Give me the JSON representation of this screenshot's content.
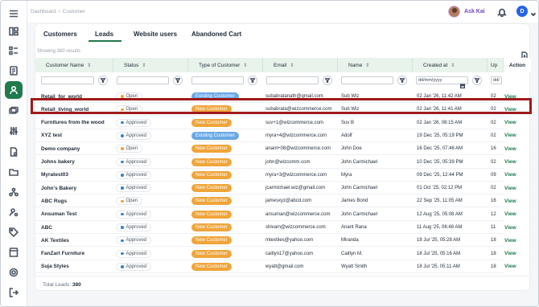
{
  "header": {
    "breadcrumb": [
      "Dashboard",
      "/",
      "Customer"
    ],
    "ask_kai": "Ask Kai",
    "user_initial": "D"
  },
  "tabs": [
    {
      "label": "Customers",
      "active": false
    },
    {
      "label": "Leads",
      "active": true
    },
    {
      "label": "Website users",
      "active": false
    },
    {
      "label": "Abandoned Cart",
      "active": false
    }
  ],
  "showing": "Showing 380 results",
  "columns": {
    "customer_name": "Customer Name",
    "status": "Status",
    "type": "Type of Customer",
    "email": "Email",
    "name": "Name",
    "created_at": "Created at",
    "up": "Up",
    "action": "Action"
  },
  "filters": {
    "date_placeholder": "dd/mm/yyyy",
    "up_placeholder": "dd/"
  },
  "colors": {
    "accent": "#1f7a4d",
    "existing_customer": "#6aa8e6",
    "new_customer": "#f0a53a",
    "open_dot": "#f0a53a",
    "approved_dot": "#3b82c4",
    "highlight": "#a0191c"
  },
  "rows": [
    {
      "customer_name": "Retail_for_world",
      "status": "Open",
      "type": "Existing Customer",
      "email": "subabratanath@gmail.com",
      "name": "Sub Wiz",
      "created_at": "02 Jan '26, 11:42 AM",
      "up": "02",
      "action": "View"
    },
    {
      "customer_name": "Retail_living_world",
      "status": "Open",
      "type": "New Customer",
      "email": "subabrata@wizcommerce.com",
      "name": "Sub Wiz",
      "created_at": "02 Jan '26, 11:41 AM",
      "up": "02",
      "action": "View"
    },
    {
      "customer_name": "Furnitures from the wood",
      "status": "Approved",
      "type": "New Customer",
      "email": "suv+1@wizcommerce.com",
      "name": "Suv B",
      "created_at": "02 Jan '26, 08:15 AM",
      "up": "02",
      "action": "View"
    },
    {
      "customer_name": "XYZ test",
      "status": "Approved",
      "type": "Existing Customer",
      "email": "myra+4@wizcommerce.com",
      "name": "Adolf",
      "created_at": "19 Dec '25, 05:19 PM",
      "up": "02",
      "action": "View"
    },
    {
      "customer_name": "Demo company",
      "status": "Open",
      "type": "New Customer",
      "email": "anant+08@wizcommerce.com",
      "name": "John Doe",
      "created_at": "16 Dec '25, 07:46 AM",
      "up": "16",
      "action": "View"
    },
    {
      "customer_name": "Johns bakery",
      "status": "Approved",
      "type": "New Customer",
      "email": "john@wizcomm.com",
      "name": "John Carmichael",
      "created_at": "10 Dec '25, 05:39 PM",
      "up": "02",
      "action": "View"
    },
    {
      "customer_name": "Myratest03",
      "status": "Approved",
      "type": "New Customer",
      "email": "myra+3@wizcommerce.com",
      "name": "Myra",
      "created_at": "09 Dec '25, 12:44 PM",
      "up": "09",
      "action": "View"
    },
    {
      "customer_name": "John's Bakery",
      "status": "Approved",
      "type": "New Customer",
      "email": "jcarmichael.wiz@gmail.com",
      "name": "John Carmichael",
      "created_at": "01 Oct '25, 02:12 PM",
      "up": "02",
      "action": "View"
    },
    {
      "customer_name": "ABC Rugs",
      "status": "Open",
      "type": "New Customer",
      "email": "jamesxyz@abcd.com",
      "name": "James Bond",
      "created_at": "22 Sep '25, 11:05 AM",
      "up": "16",
      "action": "View"
    },
    {
      "customer_name": "Ansuman Test",
      "status": "Approved",
      "type": "New Customer",
      "email": "ansuman@wizcommerce.com",
      "name": "John Carmichael",
      "created_at": "12 Aug '25, 05:08 AM",
      "up": "12",
      "action": "View"
    },
    {
      "customer_name": "ABC",
      "status": "Approved",
      "type": "New Customer",
      "email": "shivam@wizcommerce.com",
      "name": "Anant Rana",
      "created_at": "11 Aug '25, 06:48 AM",
      "up": "11",
      "action": "View"
    },
    {
      "customer_name": "AK Textiles",
      "status": "Approved",
      "type": "New Customer",
      "email": "mtextiles@yahoo.com",
      "name": "Miranda",
      "created_at": "18 Jul '25, 05:28 AM",
      "up": "18",
      "action": "View"
    },
    {
      "customer_name": "FanZart Furniture",
      "status": "Approved",
      "type": "New Customer",
      "email": "caitlyn17@yahoo.com",
      "name": "Caitlyn M.",
      "created_at": "18 Jul '25, 05:16 AM",
      "up": "18",
      "action": "View"
    },
    {
      "customer_name": "Suja Styles",
      "status": "Approved",
      "type": "New Customer",
      "email": "wyatt@gmail.com",
      "name": "Wyatt Smith",
      "created_at": "18 Jul '25, 05:11 AM",
      "up": "18",
      "action": "View"
    }
  ],
  "footer": {
    "label": "Total Leads:",
    "count": "380"
  }
}
